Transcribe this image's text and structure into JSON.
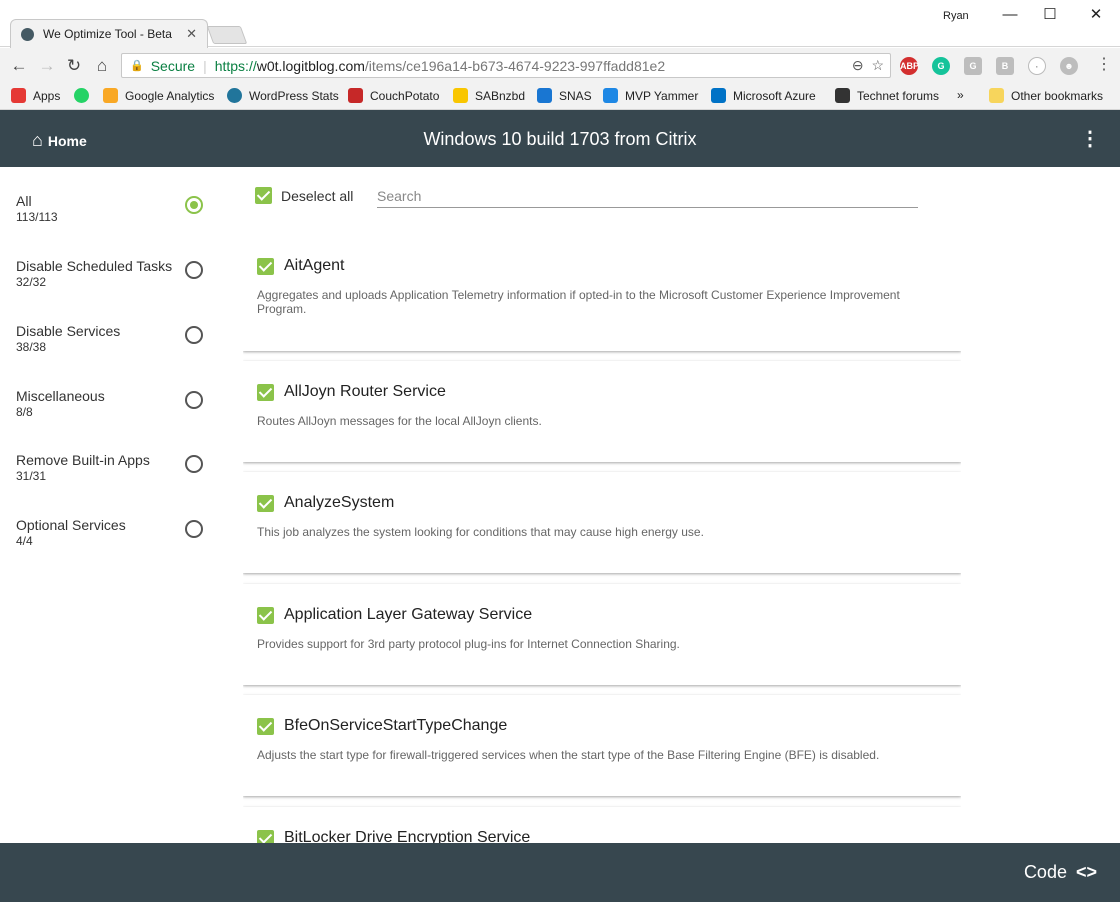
{
  "browser": {
    "tab_title": "We Optimize Tool - Beta",
    "tab_close": "✕",
    "user": "Ryan",
    "url_secure": "Secure",
    "url_scheme": "https://",
    "url_host": "w0t.logitblog.com",
    "url_path": "/items/ce196a14-b673-4674-9223-997ffadd81e2",
    "bookmarks": [
      {
        "label": "Apps",
        "color": "#e53935"
      },
      {
        "label": "",
        "color": "#25d366"
      },
      {
        "label": "Google Analytics",
        "color": "#f9a825"
      },
      {
        "label": "WordPress Stats",
        "color": "#21759b"
      },
      {
        "label": "CouchPotato",
        "color": "#c62828"
      },
      {
        "label": "SABnzbd",
        "color": "#f9c600"
      },
      {
        "label": "SNAS",
        "color": "#1976d2"
      },
      {
        "label": "MVP Yammer",
        "color": "#1e88e5"
      },
      {
        "label": "Microsoft Azure",
        "color": "#0072c6"
      },
      {
        "label": "Technet forums",
        "color": "#333333"
      }
    ],
    "more_bookmarks": "»",
    "other_bookmarks": "Other bookmarks"
  },
  "app": {
    "home_label": "Home",
    "title": "Windows 10 build 1703 from Citrix",
    "accent_color": "#8bc34a",
    "bar_color": "#37474f"
  },
  "sidebar": {
    "categories": [
      {
        "name": "All",
        "count": "113/113",
        "selected": true
      },
      {
        "name": "Disable Scheduled Tasks",
        "count": "32/32",
        "selected": false
      },
      {
        "name": "Disable Services",
        "count": "38/38",
        "selected": false
      },
      {
        "name": "Miscellaneous",
        "count": "8/8",
        "selected": false
      },
      {
        "name": "Remove Built-in Apps",
        "count": "31/31",
        "selected": false
      },
      {
        "name": "Optional Services",
        "count": "4/4",
        "selected": false
      }
    ]
  },
  "toolbar": {
    "deselect_label": "Deselect all",
    "search_placeholder": "Search"
  },
  "items": [
    {
      "title": "AitAgent",
      "description": "Aggregates and uploads Application Telemetry information if opted-in to the Microsoft Customer Experience Improvement Program.",
      "checked": true
    },
    {
      "title": "AllJoyn Router Service",
      "description": "Routes AllJoyn messages for the local AllJoyn clients.",
      "checked": true
    },
    {
      "title": "AnalyzeSystem",
      "description": "This job analyzes the system looking for conditions that may cause high energy use.",
      "checked": true
    },
    {
      "title": "Application Layer Gateway Service",
      "description": "Provides support for 3rd party protocol plug-ins for Internet Connection Sharing.",
      "checked": true
    },
    {
      "title": "BfeOnServiceStartTypeChange",
      "description": "Adjusts the start type for firewall-triggered services when the start type of the Base Filtering Engine (BFE) is disabled.",
      "checked": true
    },
    {
      "title": "BitLocker Drive Encryption Service",
      "description": "",
      "checked": true
    }
  ],
  "footer": {
    "code_label": "Code",
    "code_icon": "<>"
  }
}
